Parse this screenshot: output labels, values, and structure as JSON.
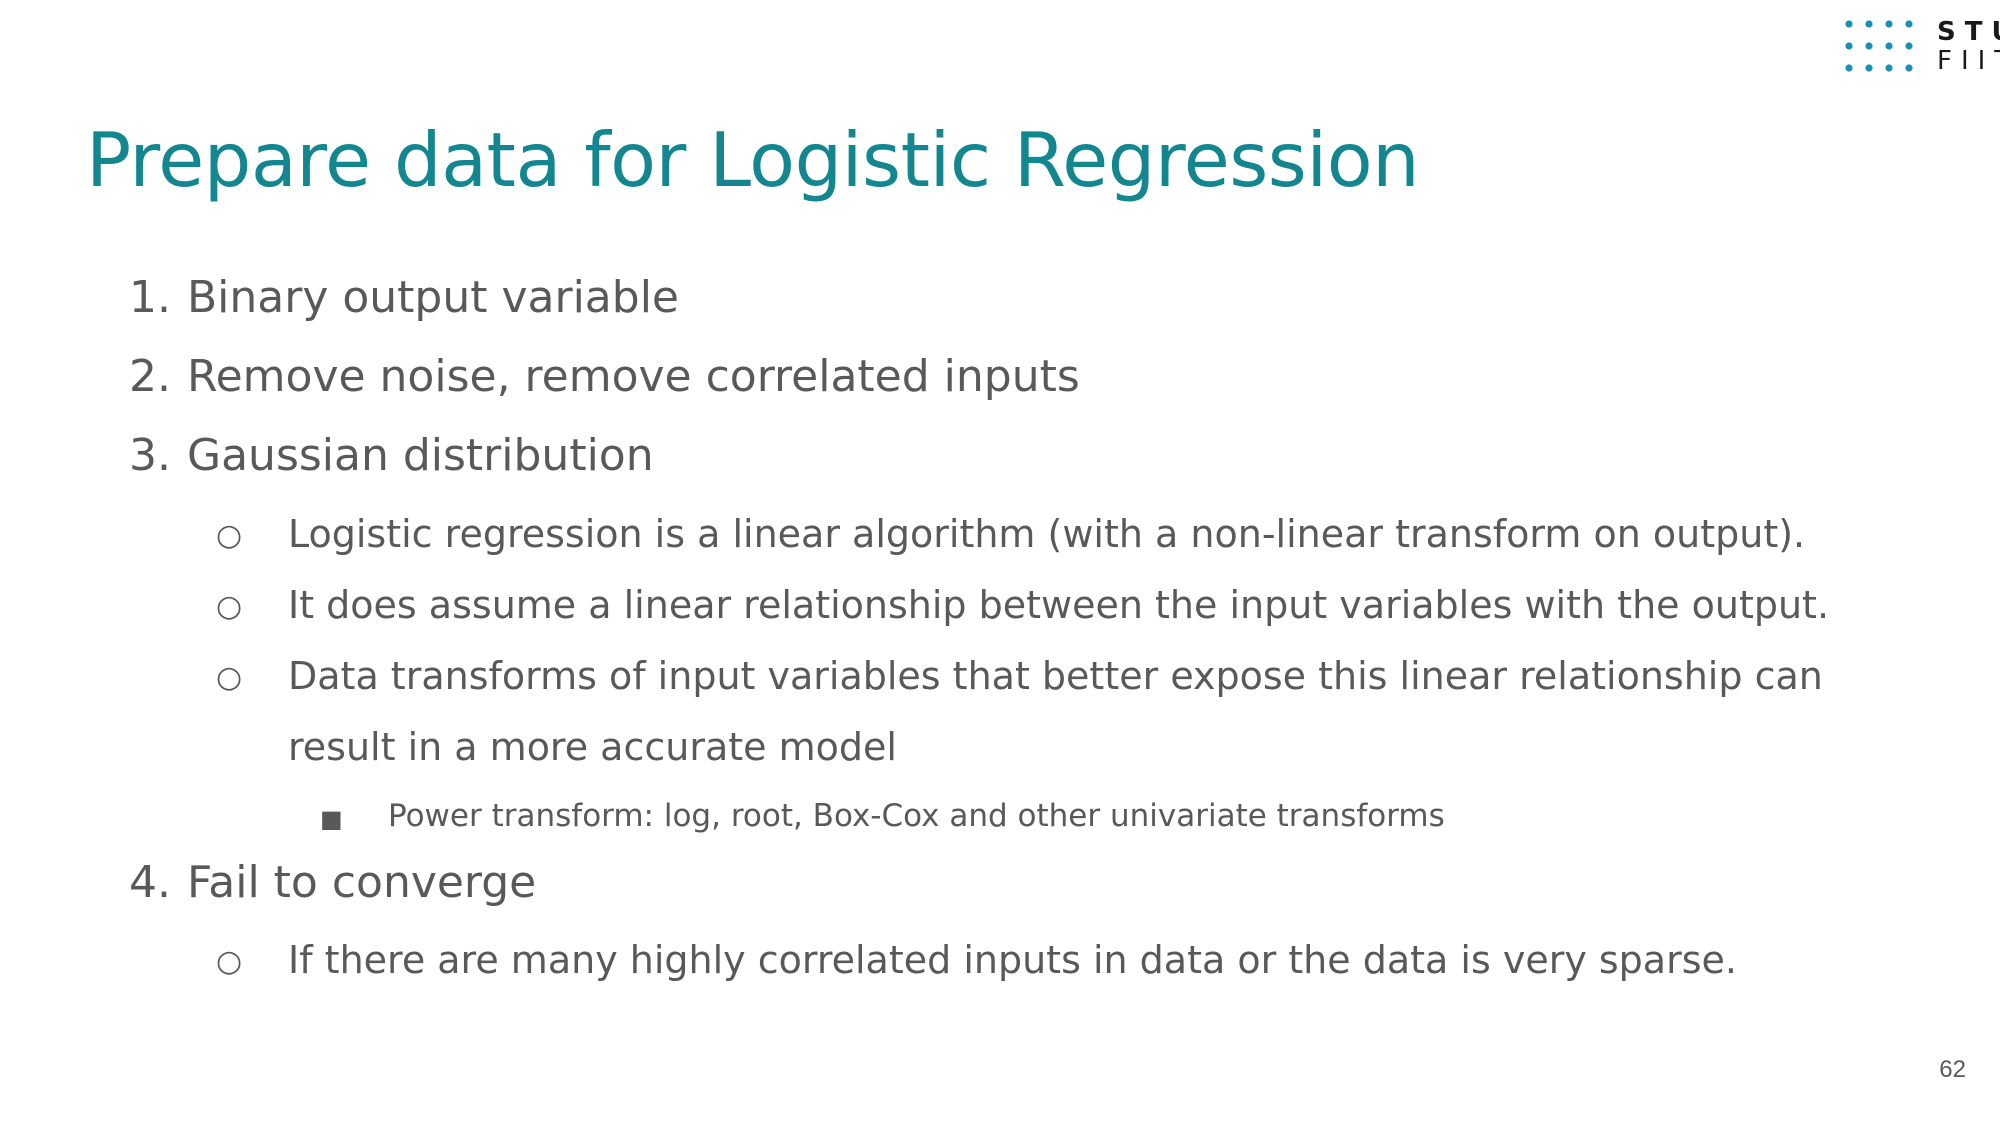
{
  "logo": {
    "line1": "STU",
    "line2": "FIIT",
    "accent_color": "#1a8fb5"
  },
  "slide": {
    "title": "Prepare data for Logistic Regression",
    "title_color": "#14868f",
    "items": [
      {
        "num": "1.",
        "text": "Binary output variable"
      },
      {
        "num": "2.",
        "text": "Remove noise, remove correlated inputs"
      },
      {
        "num": "3.",
        "text": "Gaussian distribution",
        "subitems": [
          {
            "bullet": "○",
            "text": "Logistic regression is a linear algorithm (with a non-linear transform on output)."
          },
          {
            "bullet": "○",
            "text": "It does assume a linear relationship between the input variables with the output."
          },
          {
            "bullet": "○",
            "text_line1": "Data transforms of input variables that better expose this linear relationship can",
            "text_line2": "result in a more accurate model",
            "subitems": [
              {
                "bullet": "■",
                "text": "Power transform: log, root, Box-Cox and other univariate transforms"
              }
            ]
          }
        ]
      },
      {
        "num": "4.",
        "text": "Fail to converge",
        "subitems": [
          {
            "bullet": "○",
            "text": "If there are many highly correlated inputs in data or the data is very sparse."
          }
        ]
      }
    ],
    "page_number": "62"
  }
}
